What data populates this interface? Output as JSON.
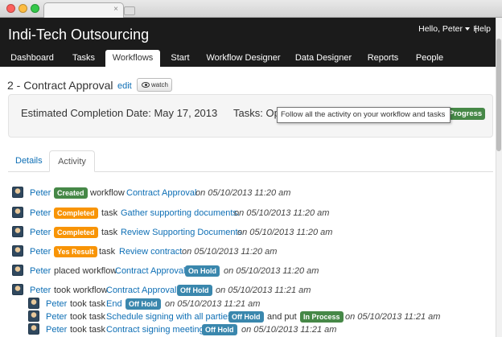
{
  "navbar": {
    "brand": "Indi-Tech Outsourcing",
    "user": "Hello, Peter",
    "separator": "|",
    "help": "Help",
    "tabs": [
      "Dashboard",
      "Tasks",
      "Workflows",
      "Start",
      "Workflow Designer",
      "Data Designer",
      "Reports",
      "People"
    ]
  },
  "page": {
    "title": "2 - Contract Approval",
    "edit": "edit",
    "watch": "watch",
    "estimated": "Estimated Completion Date: May 17, 2013",
    "tasks_label": "Tasks: Op",
    "progress_badge": "Progress",
    "tooltip": "Follow all the activity on your workflow and tasks"
  },
  "tabs": {
    "details": "Details",
    "activity": "Activity"
  },
  "colors": {
    "green": "#468847",
    "orange": "#f89406",
    "blue": "#3a87ad",
    "link": "#0e6fb5"
  },
  "activity": {
    "r1": {
      "user": "Peter",
      "badge": "Created",
      "word": "workflow",
      "item": "Contract Approval",
      "date": "on 05/10/2013 11:20 am"
    },
    "r2": {
      "user": "Peter",
      "badge": "Completed",
      "word": "task",
      "item": "Gather supporting documents.",
      "date": "on 05/10/2013 11:20 am"
    },
    "r3": {
      "user": "Peter",
      "badge": "Completed",
      "word": "task",
      "item": "Review Supporting Documents",
      "date": "on 05/10/2013 11:20 am"
    },
    "r4": {
      "user": "Peter",
      "badge": "Yes Result",
      "word": "task",
      "item": "Review contract",
      "date": "on 05/10/2013 11:20 am"
    },
    "r5": {
      "user": "Peter",
      "word": "placed workflow",
      "item": "Contract Approval",
      "badge": "On Hold",
      "date": "on 05/10/2013 11:20 am"
    },
    "r6": {
      "user": "Peter",
      "word": "took workflow",
      "item": "Contract Approval",
      "badge": "Off Hold",
      "date": "on 05/10/2013 11:21 am"
    },
    "r7": {
      "user": "Peter",
      "word": "took task",
      "item": "End",
      "badge": "Off Hold",
      "date": "on 05/10/2013 11:21 am"
    },
    "r8": {
      "user": "Peter",
      "word": "took task",
      "item": "Schedule signing with all parties",
      "badge": "Off Hold",
      "word2": "and put",
      "badge2": "In Process",
      "date": "on 05/10/2013 11:21 am"
    },
    "r9": {
      "user": "Peter",
      "word": "took task",
      "item": "Contract signing meeting",
      "badge": "Off Hold",
      "date": "on 05/10/2013 11:21 am"
    }
  }
}
